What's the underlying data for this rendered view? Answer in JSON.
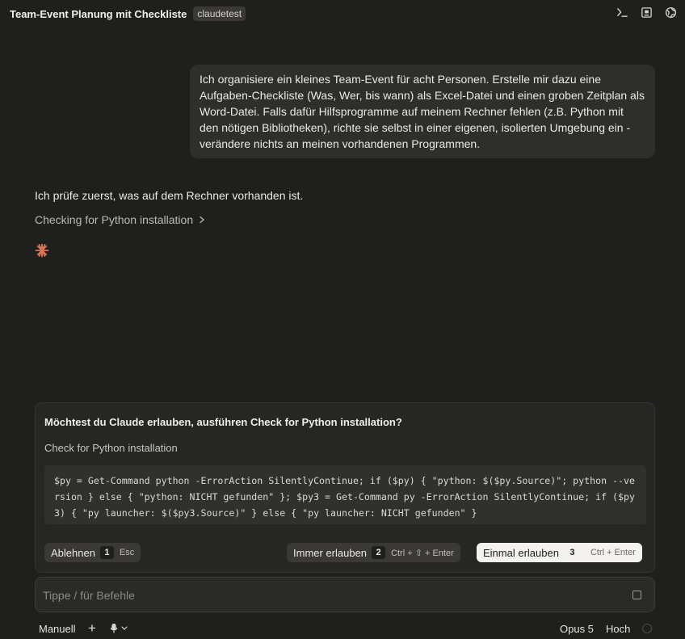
{
  "header": {
    "title": "Team-Event Planung mit Checkliste",
    "tag": "claudetest",
    "icons": [
      "terminal-icon",
      "panel-icon",
      "globe-icon"
    ]
  },
  "conversation": {
    "user_message": "Ich organisiere ein kleines Team-Event für acht Personen. Erstelle mir dazu eine Aufgaben-Checkliste (Was, Wer, bis wann) als Excel-Datei und einen groben Zeitplan als Word-Datei. Falls dafür Hilfsprogramme auf meinem Rechner fehlen (z.B. Python mit den nötigen Bibliotheken), richte sie selbst in einer eigenen, isolierten Umgebung ein - verändere nichts an meinen vorhandenen Programmen.",
    "assistant_message": "Ich prüfe zuerst, was auf dem Rechner vorhanden ist.",
    "tool_step": "Checking for Python installation"
  },
  "permission": {
    "question": "Möchtest du Claude erlauben, ausführen Check for Python installation?",
    "subtitle": "Check for Python installation",
    "command": "$py = Get-Command python -ErrorAction SilentlyContinue; if ($py) { \"python: $($py.Source)\"; python --version } else { \"python: NICHT gefunden\" }; $py3 = Get-Command py -ErrorAction SilentlyContinue; if ($py3) { \"py launcher: $($py3.Source)\" } else { \"py launcher: NICHT gefunden\" }",
    "deny": {
      "label": "Ablehnen",
      "key": "1",
      "hint": "Esc"
    },
    "always": {
      "label": "Immer erlauben",
      "key": "2",
      "hint": "Ctrl + ⇧ + Enter"
    },
    "once": {
      "label": "Einmal erlauben",
      "key": "3",
      "hint": "Ctrl + Enter"
    }
  },
  "input": {
    "placeholder": "Tippe / für Befehle",
    "value": ""
  },
  "footer": {
    "mode": "Manuell",
    "add": "+",
    "model": "Opus 5",
    "effort": "Hoch"
  },
  "colors": {
    "background": "#1f1f1e",
    "accent": "#d97757",
    "bubble": "#2e2e2c"
  }
}
